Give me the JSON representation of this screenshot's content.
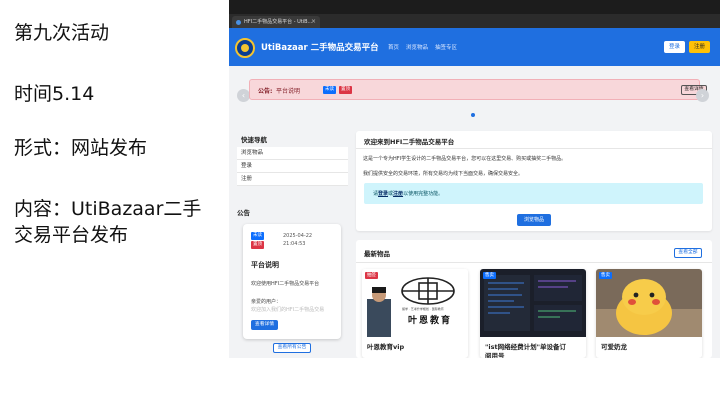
{
  "slide": {
    "title": "第九次活动",
    "time": "时间5.14",
    "form": "形式：网站发布",
    "content": "内容：UtiBazaar二手交易平台发布"
  },
  "browser": {
    "tab_title": "HFI二手物品交易平台 - UtiB...",
    "tab_close": "×"
  },
  "navbar": {
    "brand": "UtiBazaar 二手物品交易平台",
    "links": [
      "首页",
      "浏览物品",
      "抽签专区"
    ],
    "login": "登录",
    "register": "注册"
  },
  "carousel": {
    "label": "公告:",
    "title": "平台说明",
    "badge_blue": "未读",
    "badge_red": "置顶",
    "view_button": "查看详情",
    "prev_icon": "‹",
    "next_icon": "›"
  },
  "sidebar": {
    "quick_nav_title": "快速导航",
    "items": [
      "浏览物品",
      "登录",
      "注册"
    ],
    "notice_title": "公告",
    "notice": {
      "badge_blue": "未读",
      "badge_red": "置顶",
      "date": "2025-04-22",
      "time": "21:04:53",
      "title": "平台说明",
      "body1": "欢迎使用HFI二手物品交易平台",
      "body2": "亲爱的用户：",
      "body3": "欢迎加入我们的HFI二手物品交易",
      "button": "查看详情"
    },
    "all_notices": "查看所有公告"
  },
  "welcome": {
    "title": "欢迎来到HFI二手物品交易平台",
    "p1": "这是一个专为HFI学生设计的二手物品交易平台，您可以在这里交易、购买或抽奖二手物品。",
    "p2": "我们提供安全的交易环境，所有交易均为线下当面交易，确保交易安全。",
    "alert_pre": "请",
    "alert_login": "登录",
    "alert_or": "或",
    "alert_register": "注册",
    "alert_post": "以使用完整功能。",
    "browse_button": "浏览物品"
  },
  "latest": {
    "title": "最新物品",
    "view_all": "查看全部",
    "products": [
      {
        "tag": "抽签",
        "name": "叶恩教育vip"
      },
      {
        "tag": "售卖",
        "name": "\"ist网络经费计划\"单设备订",
        "name2": "阅用号"
      },
      {
        "tag": "售卖",
        "name": "可爱奶龙"
      }
    ],
    "logo_text": "叶恩教育",
    "logo_small": "留学 · 艺考升学规划 · 国际教育"
  },
  "colors": {
    "primary": "#1f6fe0",
    "warning": "#ffc107",
    "danger": "#dc3545",
    "info_bg": "#cff4fc",
    "alert_bg": "#f8d7da"
  }
}
